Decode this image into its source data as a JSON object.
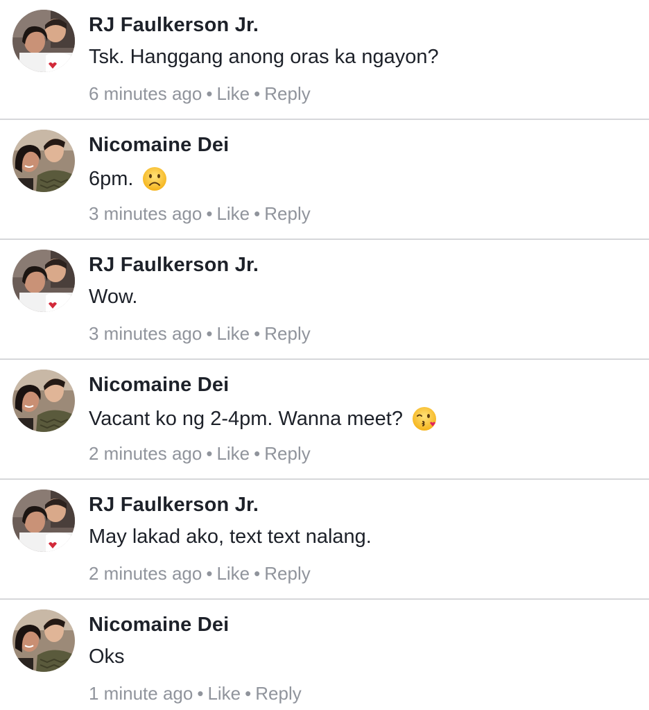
{
  "labels": {
    "like": "Like",
    "reply": "Reply",
    "separator": "•"
  },
  "comments": [
    {
      "author": "RJ Faulkerson Jr.",
      "text": "Tsk. Hanggang anong oras ka ngayon?",
      "time": "6 minutes ago",
      "avatar": "avatar-rj",
      "emoji": ""
    },
    {
      "author": "Nicomaine Dei",
      "text": "6pm.",
      "time": "3 minutes ago",
      "avatar": "avatar-nico",
      "emoji": "frowning-face-icon"
    },
    {
      "author": "RJ Faulkerson Jr.",
      "text": "Wow.",
      "time": "3 minutes ago",
      "avatar": "avatar-rj",
      "emoji": ""
    },
    {
      "author": "Nicomaine Dei",
      "text": "Vacant ko ng 2-4pm. Wanna meet?",
      "time": "2 minutes ago",
      "avatar": "avatar-nico",
      "emoji": "kissing-face-icon"
    },
    {
      "author": "RJ Faulkerson Jr.",
      "text": "May lakad ako, text text nalang.",
      "time": "2 minutes ago",
      "avatar": "avatar-rj",
      "emoji": ""
    },
    {
      "author": "Nicomaine Dei",
      "text": "Oks",
      "time": "1 minute ago",
      "avatar": "avatar-nico",
      "emoji": ""
    }
  ]
}
